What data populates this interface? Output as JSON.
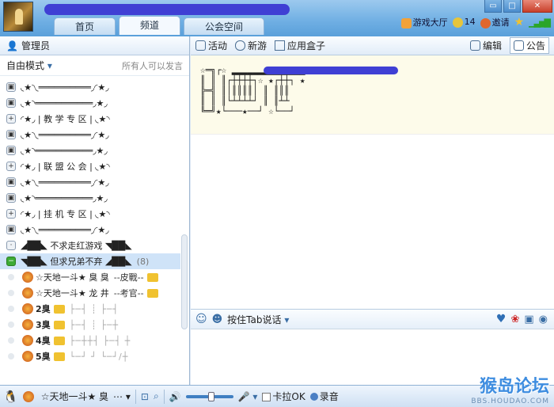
{
  "tabs": [
    {
      "label": "首页"
    },
    {
      "label": "频道"
    },
    {
      "label": "公会空间"
    }
  ],
  "top_right": {
    "game_hall": "游戏大厅",
    "coins": "14",
    "invite": "邀请"
  },
  "left": {
    "admin_label": "管理员",
    "mode_label": "自由模式",
    "mode_hint": "所有人可以发言",
    "channels": [
      {
        "text": "◟★◝◟══════════◞◜★◞"
      },
      {
        "text": "◟★◝═══════════◞★◞"
      },
      {
        "text": "◜★◞ | 教 学 专 区 | ◟★◝"
      },
      {
        "text": "◟★◝◟══════════◞◜★◞"
      },
      {
        "text": "◟★◝═══════════◞★◞"
      },
      {
        "text": "◜★◞ | 联 盟 公 会 | ◟★◝"
      },
      {
        "text": "◟★◝◟══════════◞◜★◞"
      },
      {
        "text": "◟★◝═══════════◞★◞"
      },
      {
        "text": "◜★◞ | 挂 机 专 区 | ◟★◝"
      },
      {
        "text": "◟★◝◟══════════◞◜★◞"
      },
      {
        "text": "◢██◣   不求走红游戏   ◥██◣"
      },
      {
        "text": "◥██◣   但求兄弟不弃   ◢██◣",
        "count": "(8)"
      }
    ],
    "members": [
      {
        "name": "☆天地一斗★ 臭  臭",
        "extra": "--皮戰--"
      },
      {
        "name": "☆天地一斗★ 龙  井",
        "extra": "--考官--"
      },
      {
        "name": "2臭",
        "extra": "├─┤ ┊ ├─┤"
      },
      {
        "name": "3臭",
        "extra": "├─┤ ┊ ├─┼"
      },
      {
        "name": "4臭",
        "extra": "├─┼┼┤ ├─┤ ┼"
      },
      {
        "name": "5臭",
        "extra": "└─┘ ┘ └─┘/┼"
      }
    ]
  },
  "right": {
    "toolbar": {
      "activity": "活动",
      "new_game": "新游",
      "app_box": "应用盒子",
      "edit": "编辑",
      "notice": "公告"
    },
    "notice_art": "☆═╗┌☆ ▂▂▂▂▂▂▂▂▂▂▂▂▂▂\n║ ║ ║┌┼┼┼┼┐☆ ★┌┼┼┐ ★\n╠═╣ ║│║║║║│ ║ ║║║\n║ ║ ║└┴┴┴┴┘ ║ ║┴┴\n╚═╝★└───★──┘ ☆└──┘",
    "input_bar": {
      "talk_mode": "按住Tab说话"
    }
  },
  "bottom": {
    "user_name": "☆天地一斗★ 臭",
    "karaoke_label": "卡拉OK",
    "record_label": "录音"
  },
  "watermark": {
    "main": "猴岛论坛",
    "sub": "BBS.HOUDAO.COM"
  },
  "colors": {
    "title_bar": "#6eaee3",
    "selected_row": "#cfe3f8",
    "notice_bg": "#fdfbea",
    "redaction": "#3f3fd4"
  }
}
